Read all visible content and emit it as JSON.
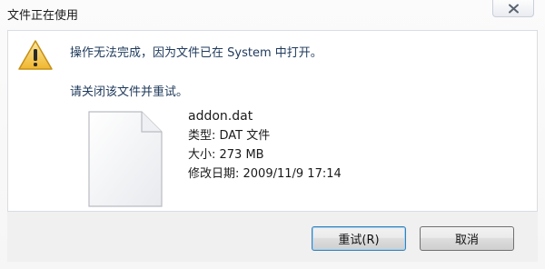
{
  "window": {
    "title": "文件正在使用"
  },
  "message": {
    "line1": "操作无法完成，因为文件已在 System 中打开。",
    "line2": "请关闭该文件并重试。"
  },
  "file": {
    "name": "addon.dat",
    "type": "类型: DAT 文件",
    "size": "大小: 273 MB",
    "modified": "修改日期: 2009/11/9 17:14"
  },
  "buttons": {
    "retry": "重试(R)",
    "cancel": "取消"
  },
  "icons": {
    "warning": "warning-icon",
    "file": "file-icon",
    "close": "close-icon"
  },
  "colors": {
    "message_text": "#1e395b",
    "warning_yellow": "#f5c342",
    "default_button_border": "#3c7fb1"
  }
}
